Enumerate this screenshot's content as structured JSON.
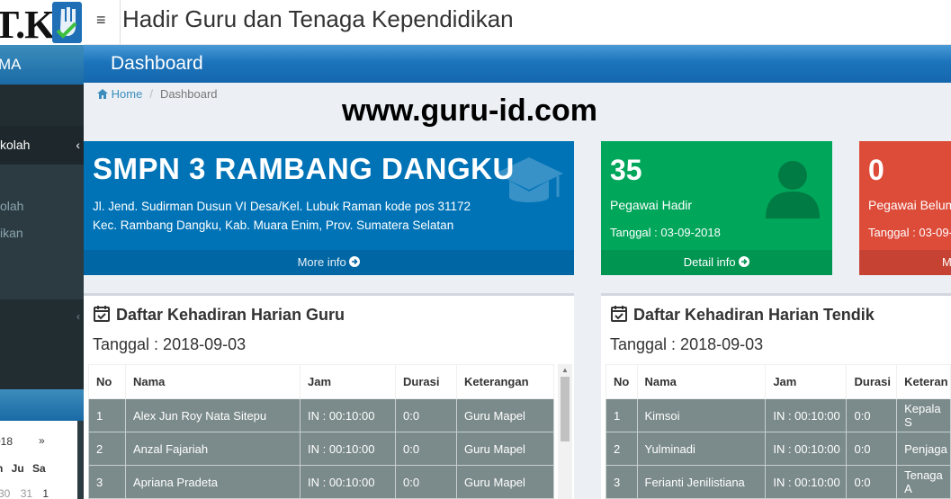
{
  "sidebar": {
    "logo_text": "T.K",
    "brand": "MA",
    "active_item": "kolah",
    "sub_items": [
      "olah",
      "ikan"
    ],
    "calendar": {
      "month_label": "018",
      "next": "»",
      "days": "n Ju Sa",
      "nums_prev": "30",
      "nums_a": "31",
      "nums_b": "1"
    }
  },
  "header": {
    "menu_icon": "≡",
    "title": "Hadir Guru dan Tenaga Kependidikan"
  },
  "page": {
    "heading": "Dashboard",
    "breadcrumb": {
      "home": "Home",
      "current": "Dashboard"
    },
    "watermark": "www.guru-id.com"
  },
  "school": {
    "name": "SMPN 3 RAMBANG DANGKU",
    "address_line1": "Jl. Jend. Sudirman Dusun VI Desa/Kel. Lubuk Raman kode pos 31172",
    "address_line2": "Kec. Rambang Dangku, Kab. Muara Enim, Prov. Sumatera Selatan",
    "footer": "More info",
    "icon": "graduation-cap-icon"
  },
  "hadir": {
    "count": "35",
    "label": "Pegawai Hadir",
    "date": "Tanggal : 03-09-2018",
    "footer": "Detail info",
    "icon": "person-icon",
    "color": "#00a65a"
  },
  "belum": {
    "count": "0",
    "label": "Pegawai Belum",
    "date": "Tanggal : 03-09-",
    "footer": "M",
    "color": "#dd4b39"
  },
  "guru_panel": {
    "title": "Daftar Kehadiran Harian Guru",
    "date": "Tanggal : 2018-09-03",
    "columns": [
      "No",
      "Nama",
      "Jam",
      "Durasi",
      "Keterangan"
    ],
    "rows": [
      [
        "1",
        "Alex Jun Roy Nata Sitepu",
        "IN : 00:10:00",
        "0:0",
        "Guru Mapel"
      ],
      [
        "2",
        "Anzal Fajariah",
        "IN : 00:10:00",
        "0:0",
        "Guru Mapel"
      ],
      [
        "3",
        "Apriana Pradeta",
        "IN : 00:10:00",
        "0:0",
        "Guru Mapel"
      ]
    ]
  },
  "tendik_panel": {
    "title": "Daftar Kehadiran Harian Tendik",
    "date": "Tanggal : 2018-09-03",
    "columns": [
      "No",
      "Nama",
      "Jam",
      "Durasi",
      "Keteran"
    ],
    "rows": [
      [
        "1",
        "Kimsoi",
        "IN : 00:10:00",
        "0:0",
        "Kepala S"
      ],
      [
        "2",
        "Yulminadi",
        "IN : 00:10:00",
        "0:0",
        "Penjaga"
      ],
      [
        "3",
        "Ferianti Jenilistiana",
        "IN : 00:10:00",
        "0:0",
        "Tenaga A"
      ]
    ]
  }
}
